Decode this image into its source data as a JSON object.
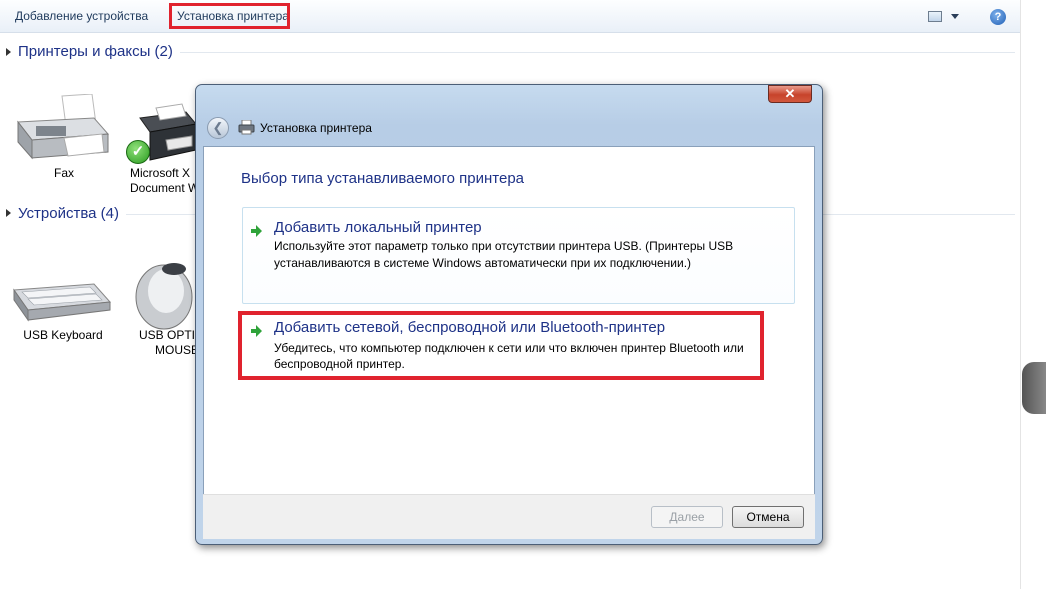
{
  "toolbar": {
    "add_device_label": "Добавление устройства",
    "install_printer_label": "Установка принтера",
    "help_label": "?"
  },
  "groups": {
    "printers_title": "Принтеры и факсы (2)",
    "devices_title": "Устройства (4)"
  },
  "printers": [
    {
      "label": "Fax"
    },
    {
      "label_line1": "Microsoft X",
      "label_line2": "Document W"
    }
  ],
  "devices": [
    {
      "label": "USB Keyboard"
    },
    {
      "label_line1": "USB OPTIC",
      "label_line2": "MOUSE"
    }
  ],
  "dialog": {
    "close_label": "✕",
    "title": "Установка принтера",
    "heading": "Выбор типа устанавливаемого принтера",
    "option_local": {
      "title": "Добавить локальный принтер",
      "desc_line1": "Используйте этот параметр только при отсутствии принтера USB. (Принтеры USB",
      "desc_line2": "устанавливаются в системе Windows автоматически при их подключении.)"
    },
    "option_network": {
      "title": "Добавить сетевой, беспроводной или Bluetooth-принтер",
      "desc_line1": "Убедитесь, что компьютер подключен к сети или что включен принтер Bluetooth или",
      "desc_line2": "беспроводной принтер."
    },
    "next_label": "Далее",
    "cancel_label": "Отмена"
  },
  "colors": {
    "highlight": "#e0232e",
    "heading_blue": "#1e3287",
    "arrow_green": "#2fa33a"
  }
}
